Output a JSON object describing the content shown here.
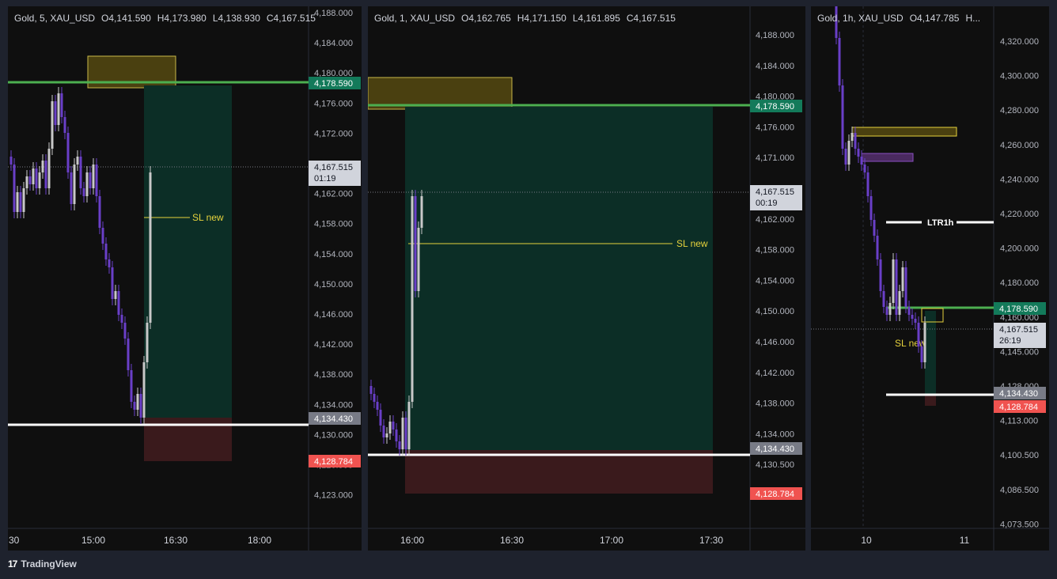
{
  "charts": [
    {
      "header": {
        "symbol": "Gold, 5, XAU_USD",
        "open": "O4,141.590",
        "high": "H4,173.980",
        "low": "L4,138.930",
        "close": "C4,167.515"
      },
      "y_ticks": [
        "4,188.000",
        "4,184.000",
        "4,180.000",
        "4,176.000",
        "4,172.000",
        "4,166.000",
        "4,162.000",
        "4,158.000",
        "4,154.000",
        "4,150.000",
        "4,146.000",
        "4,142.000",
        "4,138.000",
        "4,134.000",
        "4,130.000",
        "4,126.500",
        "4,123.000"
      ],
      "x_ticks": [
        ":30",
        "15:00",
        "16:30",
        "18:00"
      ],
      "labels": {
        "tp": "4,178.590",
        "price": "4,167.515",
        "countdown": "01:19",
        "sl_level": "4,134.430",
        "stop": "4,128.784"
      },
      "annotation": "SL new"
    },
    {
      "header": {
        "symbol": "Gold, 1, XAU_USD",
        "open": "O4,162.765",
        "high": "H4,171.150",
        "low": "L4,161.895",
        "close": "C4,167.515"
      },
      "y_ticks": [
        "4,188.000",
        "4,184.000",
        "4,180.000",
        "4,176.000",
        "4,171.000",
        "4,166.000",
        "4,162.000",
        "4,158.000",
        "4,154.000",
        "4,150.000",
        "4,146.000",
        "4,142.000",
        "4,138.000",
        "4,134.000",
        "4,130.500",
        "4,127.000"
      ],
      "x_ticks": [
        "16:00",
        "16:30",
        "17:00",
        "17:30"
      ],
      "labels": {
        "tp": "4,178.590",
        "price": "4,167.515",
        "countdown": "00:19",
        "sl_level": "4,134.430",
        "stop": "4,128.784"
      },
      "annotation": "SL new"
    },
    {
      "header": {
        "symbol": "Gold, 1h, XAU_USD",
        "open": "O4,147.785",
        "more": "H..."
      },
      "y_ticks": [
        "4,320.000",
        "4,300.000",
        "4,280.000",
        "4,260.000",
        "4,240.000",
        "4,220.000",
        "4,200.000",
        "4,180.000",
        "4,160.000",
        "4,145.000",
        "4,128.000",
        "4,113.000",
        "4,100.500",
        "4,086.500",
        "4,073.500"
      ],
      "x_ticks": [
        "10",
        "11"
      ],
      "labels": {
        "tp": "4,178.590",
        "price": "4,167.515",
        "countdown": "26:19",
        "sl_level": "4,134.430",
        "stop": "4,128.784"
      },
      "annotation": "SL new",
      "ltr_label": "LTR1h"
    }
  ],
  "footer": {
    "brand": "TradingView",
    "logo": "17"
  },
  "colors": {
    "bg": "#0f0f0f",
    "panel_bg": "#1e222d",
    "bull": "#c8c8c8",
    "bear": "#6a3fc8",
    "tp_line": "#4caf50",
    "tp_label": "#137a5a",
    "stop_label": "#f05350",
    "sl_label": "#787b86",
    "zone_yellow": "#5a4f10"
  }
}
